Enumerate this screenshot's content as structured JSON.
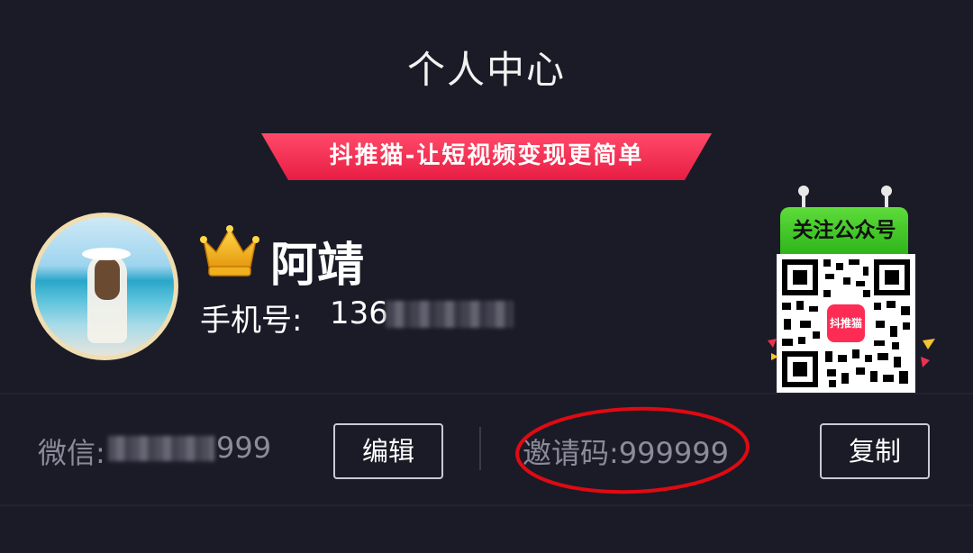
{
  "header": {
    "title": "个人中心"
  },
  "banner": {
    "text": "抖推猫-让短视频变现更简单",
    "color": "#fe2c55"
  },
  "profile": {
    "username": "阿靖",
    "phone_label": "手机号:",
    "phone_visible": "136"
  },
  "qr": {
    "header_text": "关注公众号",
    "logo_text": "抖推猫"
  },
  "wechat": {
    "label": "微信:",
    "visible_tail": "999"
  },
  "actions": {
    "edit_label": "编辑",
    "copy_label": "复制"
  },
  "invite": {
    "label": "邀请码:",
    "code": "999999",
    "highlight_color": "#e00a12"
  },
  "icons": [
    "crown-icon",
    "qr-code"
  ]
}
